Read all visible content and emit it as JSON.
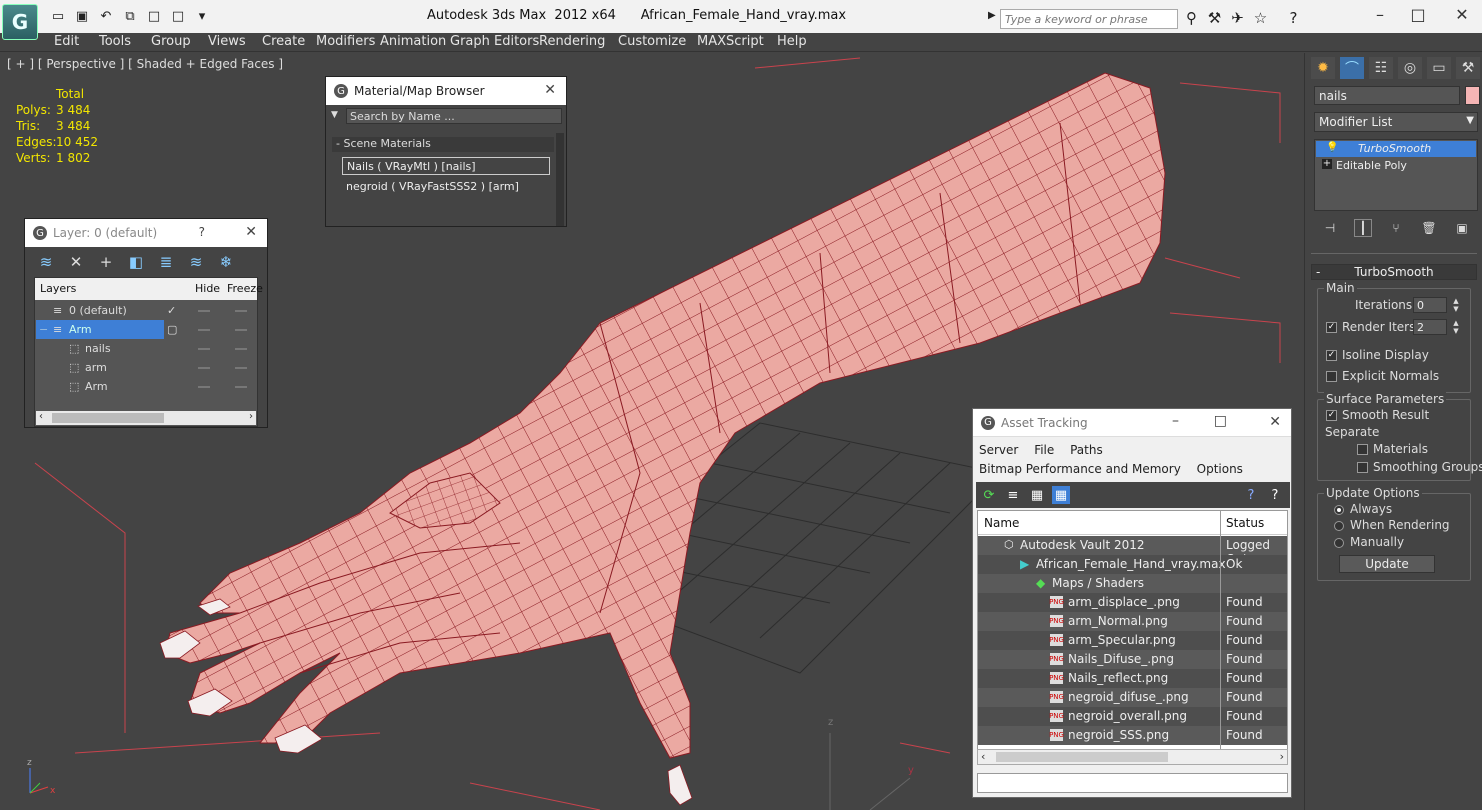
{
  "app": {
    "title": "Autodesk 3ds Max  2012 x64",
    "file": "African_Female_Hand_vray.max",
    "search_placeholder": "Type a keyword or phrase"
  },
  "menu": [
    "Edit",
    "Tools",
    "Group",
    "Views",
    "Create",
    "Modifiers",
    "Animation",
    "Graph Editors",
    "Rendering",
    "Customize",
    "MAXScript",
    "Help"
  ],
  "viewport": {
    "label": "[ + ] [ Perspective ] [ Shaded + Edged Faces ]",
    "stats": {
      "header": "Total",
      "rows": [
        {
          "label": "Polys:",
          "value": "3 484"
        },
        {
          "label": "Tris:",
          "value": "3 484"
        },
        {
          "label": "Edges:",
          "value": "10 452"
        },
        {
          "label": "Verts:",
          "value": "1 802"
        }
      ]
    },
    "axis": {
      "x": "x",
      "y": "y",
      "z": "z"
    }
  },
  "material_browser": {
    "title": "Material/Map Browser",
    "search_placeholder": "Search by Name ...",
    "section": "- Scene Materials",
    "items": [
      "Nails  ( VRayMtl )  [nails]",
      "negroid  ( VRayFastSSS2 )  [arm]"
    ]
  },
  "layer_window": {
    "title": "Layer: 0 (default)",
    "help": "?",
    "columns": [
      "Layers",
      "Hide",
      "Freeze"
    ],
    "rows": [
      "0 (default)",
      "Arm",
      "nails",
      "arm",
      "Arm"
    ]
  },
  "asset_tracking": {
    "title": "Asset Tracking",
    "menu_row1": [
      "Server",
      "File",
      "Paths"
    ],
    "menu_row2": [
      "Bitmap Performance and Memory",
      "Options"
    ],
    "columns": [
      "Name",
      "Status"
    ],
    "rows": [
      {
        "name": "Autodesk Vault 2012",
        "status": "Logged Out"
      },
      {
        "name": "African_Female_Hand_vray.max",
        "status": "Ok"
      },
      {
        "name": "Maps / Shaders",
        "status": ""
      },
      {
        "name": "arm_displace_.png",
        "status": "Found"
      },
      {
        "name": "arm_Normal.png",
        "status": "Found"
      },
      {
        "name": "arm_Specular.png",
        "status": "Found"
      },
      {
        "name": "Nails_Difuse_.png",
        "status": "Found"
      },
      {
        "name": "Nails_reflect.png",
        "status": "Found"
      },
      {
        "name": "negroid_difuse_.png",
        "status": "Found"
      },
      {
        "name": "negroid_overall.png",
        "status": "Found"
      },
      {
        "name": "negroid_SSS.png",
        "status": "Found"
      }
    ],
    "png_tag": "PNG"
  },
  "command_panel": {
    "object_name": "nails",
    "object_color": "#f5b5b5",
    "modifier_list": "Modifier List",
    "stack": [
      "TurboSmooth",
      "Editable Poly"
    ],
    "rollout": "TurboSmooth",
    "main": {
      "group": "Main",
      "iterations_label": "Iterations:",
      "iterations": "0",
      "render_iters_label": "Render Iters:",
      "render_iters": "2",
      "isoline": "Isoline Display",
      "explicit": "Explicit Normals"
    },
    "surface": {
      "group": "Surface Parameters",
      "smooth": "Smooth Result",
      "separate": "Separate",
      "materials": "Materials",
      "smoothing": "Smoothing Groups"
    },
    "update": {
      "group": "Update Options",
      "always": "Always",
      "when_rendering": "When Rendering",
      "manually": "Manually",
      "button": "Update"
    }
  },
  "colors": {
    "stats": "#f2e600",
    "mesh_fill": "#e8a7a0",
    "wire": "#8a1a22",
    "grid": "#2d2d2d",
    "selection": "#3e7fd6"
  }
}
